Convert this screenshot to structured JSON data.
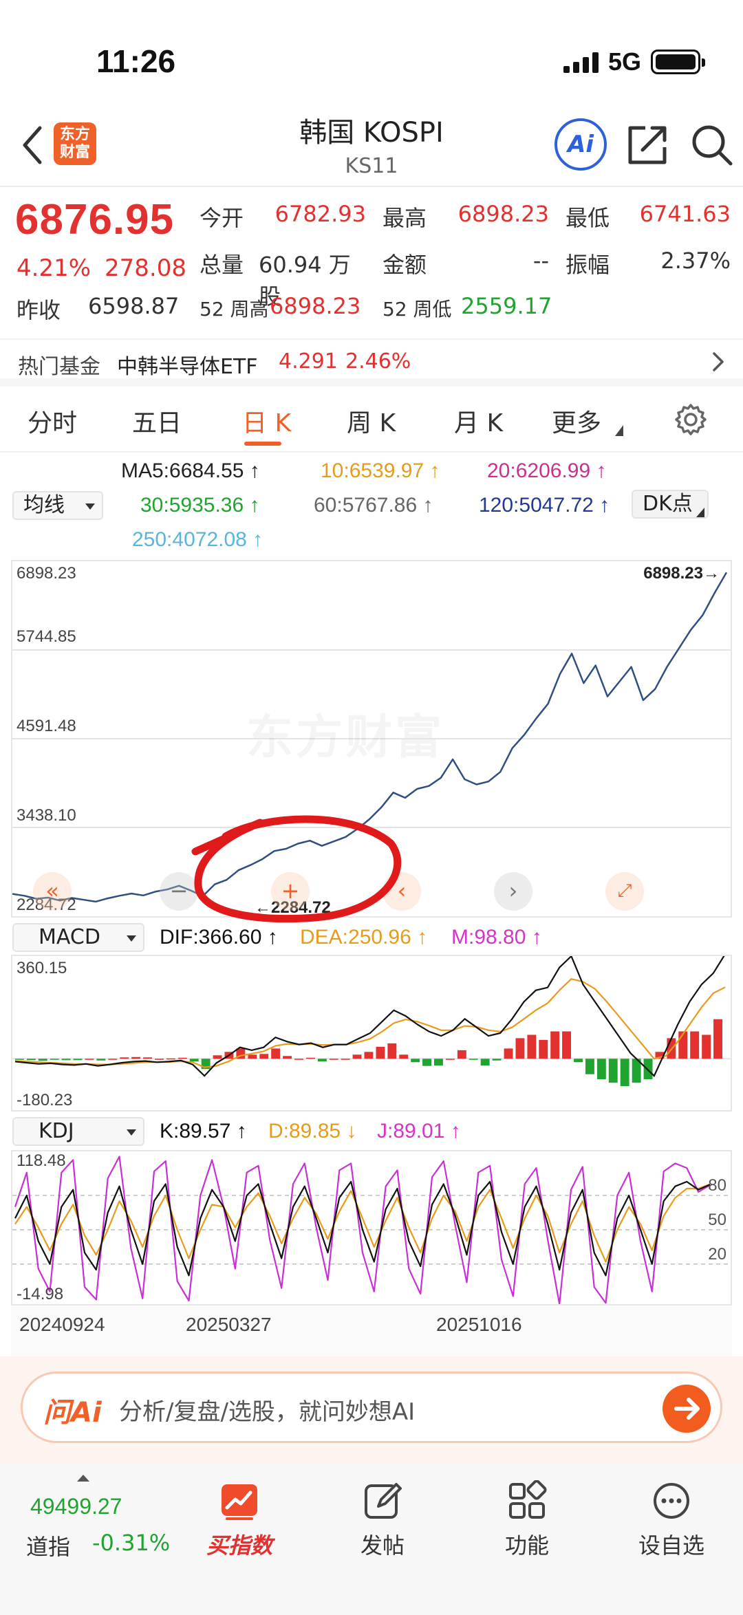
{
  "status": {
    "time": "11:26",
    "network": "5G"
  },
  "header": {
    "logo_text": "东方财富",
    "title": "韩国 KOSPI",
    "subtitle": "KS11",
    "ai_label": "Ai"
  },
  "quote": {
    "price": "6876.95",
    "change_pct": "4.21%",
    "change_abs": "278.08",
    "open_label": "今开",
    "open": "6782.93",
    "high_label": "最高",
    "high": "6898.23",
    "low_label": "最低",
    "low": "6741.63",
    "volume_label": "总量",
    "volume": "60.94 万股",
    "amount_label": "金额",
    "amount": "--",
    "amplitude_label": "振幅",
    "amplitude": "2.37%",
    "prev_close_label": "昨收",
    "prev_close": "6598.87",
    "w52_high_label": "52 周高",
    "w52_high": "6898.23",
    "w52_low_label": "52 周低",
    "w52_low": "2559.17"
  },
  "fund": {
    "label": "热门基金",
    "name": "中韩半导体ETF",
    "price": "4.291",
    "pct": "2.46%"
  },
  "tabs": [
    {
      "label": "分时"
    },
    {
      "label": "五日"
    },
    {
      "label": "日 K"
    },
    {
      "label": "周 K"
    },
    {
      "label": "月 K"
    },
    {
      "label": "更多"
    }
  ],
  "ma": {
    "selector": "均线",
    "dk_label": "DK点",
    "ma5": "MA5:6684.55 ↑",
    "ma10": "10:6539.97 ↑",
    "ma20": "20:6206.99 ↑",
    "ma30": "30:5935.36 ↑",
    "ma60": "60:5767.86 ↑",
    "ma120": "120:5047.72 ↑",
    "ma250": "250:4072.08 ↑"
  },
  "colors": {
    "up": "#e2312f",
    "down": "#1ea42f",
    "brand": "#f0612a",
    "price_line": "#2f4f80",
    "dif": "#111111",
    "dea": "#e89a1a",
    "macd_m": "#d633c9",
    "k_line": "#111111",
    "d_line": "#e89a1a",
    "j_line": "#c92fd6",
    "ma10": "#e89a1a",
    "ma20": "#c9308f",
    "ma30": "#1ea42f",
    "ma60": "#666666",
    "ma120": "#23388f",
    "ma250": "#5ab4e0"
  },
  "chart_data": [
    {
      "type": "line",
      "series": [
        {
          "values": [
            2530,
            2505,
            2465,
            2480,
            2440,
            2475,
            2450,
            2425,
            2470,
            2505,
            2535,
            2510,
            2560,
            2590,
            2640,
            2575,
            2500,
            2660,
            2720,
            2850,
            2920,
            3000,
            3110,
            3140,
            3210,
            3250,
            3180,
            3240,
            3300,
            3410,
            3540,
            3700,
            3900,
            3830,
            3950,
            3990,
            4100,
            4350,
            4080,
            4010,
            4050,
            4180,
            4500,
            4680,
            4900,
            5100,
            5500,
            5780,
            5380,
            5620,
            5200,
            5400,
            5600,
            5150,
            5300,
            5600,
            5850,
            6100,
            6300,
            6600,
            6876.95
          ]
        }
      ],
      "y_ticks": [
        "6898.23",
        "5744.85",
        "4591.48",
        "3438.10",
        "2284.72"
      ],
      "annotations": {
        "max": "6898.23",
        "min": "2284.72"
      },
      "ylim": [
        2284.72,
        6898.23
      ]
    },
    {
      "type": "bar",
      "selector": "MACD",
      "labels": {
        "dif": "DIF:366.60 ↑",
        "dea": "DEA:250.96 ↑",
        "m": "M:98.80 ↑"
      },
      "y_ticks": [
        "360.15",
        "-180.23"
      ],
      "ylim": [
        -180.23,
        360.15
      ],
      "series": [
        {
          "name": "DIF",
          "values": [
            -10,
            -14,
            -18,
            -16,
            -20,
            -22,
            -18,
            -25,
            -20,
            -14,
            -10,
            -8,
            -12,
            -10,
            -6,
            -20,
            -60,
            -15,
            10,
            40,
            30,
            40,
            75,
            60,
            50,
            55,
            40,
            50,
            50,
            70,
            90,
            130,
            170,
            150,
            120,
            95,
            80,
            100,
            140,
            110,
            80,
            90,
            140,
            200,
            240,
            250,
            320,
            360,
            260,
            200,
            140,
            80,
            20,
            -20,
            -60,
            30,
            120,
            200,
            260,
            300,
            366.6
          ]
        },
        {
          "name": "DEA",
          "values": [
            -8,
            -10,
            -12,
            -14,
            -16,
            -18,
            -18,
            -20,
            -20,
            -18,
            -15,
            -12,
            -12,
            -11,
            -9,
            -12,
            -30,
            -25,
            -10,
            10,
            18,
            26,
            45,
            52,
            50,
            52,
            48,
            50,
            50,
            58,
            70,
            95,
            125,
            138,
            130,
            116,
            100,
            100,
            115,
            112,
            100,
            95,
            110,
            140,
            170,
            195,
            240,
            280,
            270,
            245,
            200,
            150,
            100,
            50,
            0,
            10,
            60,
            120,
            180,
            230,
            250.96
          ]
        }
      ]
    },
    {
      "type": "line",
      "selector": "KDJ",
      "labels": {
        "k": "K:89.57 ↑",
        "d": "D:89.85 ↓",
        "j": "J:89.01 ↑"
      },
      "y_ticks": [
        "118.48",
        "-14.98"
      ],
      "right_ticks": [
        "80",
        "50",
        "20"
      ],
      "ylim": [
        -14.98,
        118.48
      ],
      "series": [
        {
          "name": "K",
          "values": [
            60,
            80,
            40,
            20,
            70,
            85,
            30,
            15,
            65,
            88,
            50,
            20,
            75,
            90,
            35,
            10,
            60,
            85,
            70,
            40,
            80,
            90,
            55,
            25,
            70,
            88,
            60,
            30,
            78,
            92,
            50,
            22,
            68,
            86,
            40,
            18,
            72,
            90,
            62,
            28,
            80,
            92,
            48,
            20,
            70,
            88,
            55,
            15,
            65,
            85,
            30,
            10,
            60,
            80,
            50,
            20,
            75,
            88,
            92,
            85,
            89.57
          ]
        },
        {
          "name": "D",
          "values": [
            55,
            70,
            52,
            32,
            55,
            72,
            45,
            28,
            50,
            75,
            58,
            35,
            62,
            80,
            50,
            25,
            50,
            72,
            70,
            52,
            70,
            82,
            62,
            38,
            60,
            78,
            64,
            42,
            66,
            84,
            60,
            35,
            58,
            78,
            52,
            30,
            60,
            80,
            66,
            40,
            70,
            85,
            60,
            34,
            60,
            80,
            62,
            30,
            55,
            75,
            45,
            22,
            50,
            70,
            55,
            32,
            62,
            78,
            86,
            86,
            89.85
          ]
        },
        {
          "name": "J",
          "values": [
            70,
            100,
            16,
            -4,
            100,
            111,
            0,
            -11,
            95,
            114,
            34,
            -10,
            101,
            110,
            5,
            -12,
            80,
            111,
            70,
            16,
            100,
            106,
            41,
            -1,
            90,
            108,
            52,
            6,
            102,
            108,
            30,
            -4,
            88,
            102,
            16,
            -6,
            96,
            110,
            54,
            4,
            100,
            106,
            24,
            -8,
            90,
            104,
            41,
            -15,
            85,
            105,
            0,
            -14,
            80,
            100,
            40,
            -4,
            101,
            108,
            104,
            83,
            89.01
          ]
        }
      ],
      "x_ticks": [
        "20240924",
        "20250327",
        "20251016"
      ]
    }
  ],
  "ai_bar": {
    "logo": "问Ai",
    "placeholder": "分析/复盘/选股，就问妙想AI"
  },
  "bottom_nav": {
    "dow_value": "49499.27",
    "dow_label": "道指",
    "dow_pct": "-0.31%",
    "items": [
      {
        "label": "买指数"
      },
      {
        "label": "发帖"
      },
      {
        "label": "功能"
      },
      {
        "label": "设自选"
      }
    ]
  }
}
